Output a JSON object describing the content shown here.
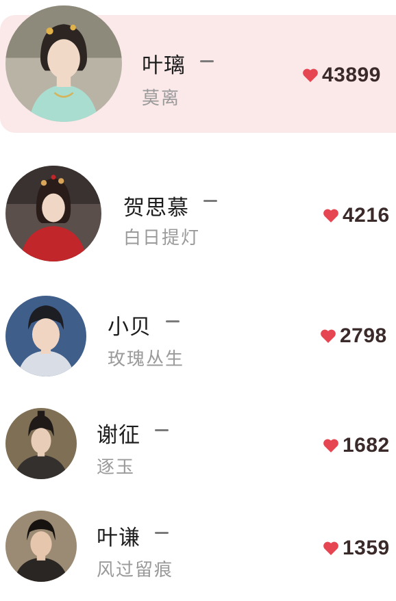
{
  "colors": {
    "heart": "#e64552",
    "highlight_bg": "#fbe9ea",
    "drama_text": "#9a9a9a"
  },
  "rankings": [
    {
      "character": "叶璃",
      "drama": "莫离",
      "heat": "43899",
      "highlighted": true
    },
    {
      "character": "贺思慕",
      "drama": "白日提灯",
      "heat": "4216",
      "highlighted": false
    },
    {
      "character": "小贝",
      "drama": "玫瑰丛生",
      "heat": "2798",
      "highlighted": false
    },
    {
      "character": "谢征",
      "drama": "逐玉",
      "heat": "1682",
      "highlighted": false
    },
    {
      "character": "叶谦",
      "drama": "风过留痕",
      "heat": "1359",
      "highlighted": false
    }
  ]
}
